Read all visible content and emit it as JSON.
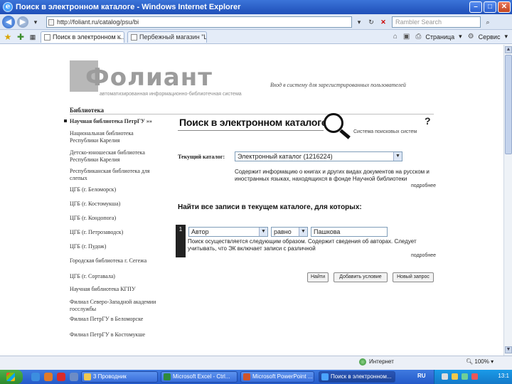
{
  "window": {
    "title": "Поиск в электронном каталоге - Windows Internet Explorer",
    "address": "http://foliant.ru/catalog/psu/bi",
    "search_placeholder": "Rambler Search"
  },
  "tabs": [
    {
      "label": "Поиск в электронном к..."
    },
    {
      "label": "Пербежный магазин \"Шлагбаум\""
    }
  ],
  "command_bar": {
    "page_label": "Страница",
    "service_label": "Сервис"
  },
  "page": {
    "logo_text": "Фолиант",
    "logo_subtitle": "автоматизированная информационно-библиотечная система",
    "login_link": "Вход в систему для зарегистрированных пользователей",
    "library_header": "Библиотека",
    "sidebar": [
      {
        "label": "Научная библиотека ПетрГУ »»",
        "active": true
      },
      {
        "label": "Национальная библиотека Республики Карелия"
      },
      {
        "label": "Детско-юношеская библиотека Республики Карелия"
      },
      {
        "label": "Республиканская библиотека для слепых"
      },
      {
        "label": "ЦГБ (г. Беломорск)"
      },
      {
        "label": "ЦГБ (г. Костомукша)"
      },
      {
        "label": "ЦГБ (г. Кондопога)"
      },
      {
        "label": "ЦГБ (г. Петрозаводск)"
      },
      {
        "label": "ЦГБ (г. Пудож)"
      },
      {
        "label": "Городская библиотека г. Сегежа"
      },
      {
        "label": "ЦГБ (г. Сортавала)"
      },
      {
        "label": "Научная библиотека КГПУ"
      },
      {
        "label": "Филиал Северо-Западной академии госслужбы"
      },
      {
        "label": "Филиал ПетрГУ в Беломорске"
      },
      {
        "label": "Филиал ПетрГУ в Костомукше"
      }
    ],
    "search_title": "Поиск в электронном каталоге",
    "help_mark": "?",
    "system_link": "Система поисковых систем",
    "current_catalog_label": "Текущий каталог:",
    "current_catalog_value": "Электронный каталог (1216224)",
    "catalog_description": "Содержит информацию о книгах и других видах документов на русском и иностранных языках, находящихся в фонде Научной библиотеки",
    "more_label": "подробнее",
    "find_title": "Найти все записи в текущем каталоге, для которых:",
    "condition": {
      "number": "1",
      "field": "Автор",
      "operator": "равно",
      "value": "Пашкова",
      "help": "Поиск осуществляется следующим образом. Содержит сведения об авторах. Следует учитывать, что ЭК включает записи с различной"
    },
    "buttons": {
      "find": "Найти",
      "add_condition": "Добавить условие",
      "new_query": "Новый запрос"
    }
  },
  "status": {
    "zone": "Интернет",
    "zoom": "100%"
  },
  "taskbar": {
    "items": [
      {
        "label": "3 Проводник"
      },
      {
        "label": "Microsoft Excel - Ctrl..."
      },
      {
        "label": "Microsoft PowerPoint ..."
      },
      {
        "label": "Поиск в электронном..."
      }
    ],
    "lang": "RU",
    "clock": "13:1"
  },
  "colors": {
    "titlebar": "#1f4fb8",
    "taskbar": "#245ac9",
    "start": "#2e8a2e"
  }
}
